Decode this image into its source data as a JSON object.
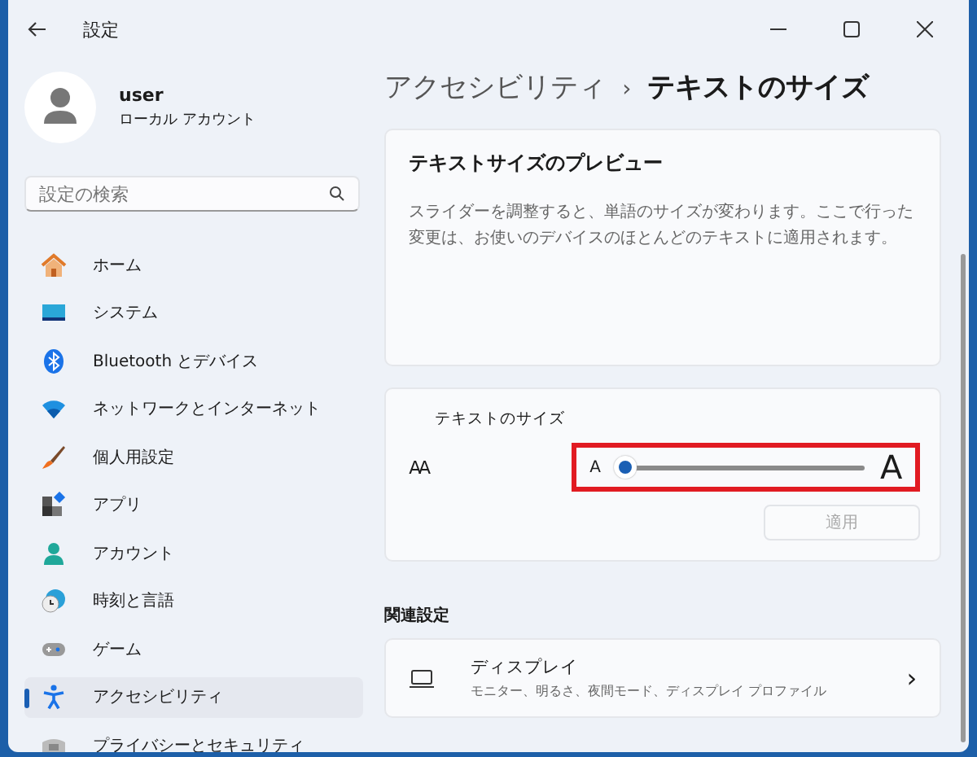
{
  "window": {
    "title": "設定"
  },
  "user": {
    "name": "user",
    "account": "ローカル アカウント"
  },
  "search": {
    "placeholder": "設定の検索"
  },
  "nav": [
    {
      "label": "ホーム",
      "kind": "home",
      "selected": false
    },
    {
      "label": "システム",
      "kind": "system",
      "selected": false
    },
    {
      "label": "Bluetooth とデバイス",
      "kind": "bluetooth",
      "selected": false
    },
    {
      "label": "ネットワークとインターネット",
      "kind": "network",
      "selected": false
    },
    {
      "label": "個人用設定",
      "kind": "brush",
      "selected": false
    },
    {
      "label": "アプリ",
      "kind": "apps",
      "selected": false
    },
    {
      "label": "アカウント",
      "kind": "account",
      "selected": false
    },
    {
      "label": "時刻と言語",
      "kind": "time",
      "selected": false
    },
    {
      "label": "ゲーム",
      "kind": "game",
      "selected": false
    },
    {
      "label": "アクセシビリティ",
      "kind": "accessibility",
      "selected": true
    },
    {
      "label": "プライバシーとセキュリティ",
      "kind": "privacy",
      "selected": false
    }
  ],
  "breadcrumb": {
    "parent": "アクセシビリティ",
    "separator": "›",
    "current": "テキストのサイズ"
  },
  "preview": {
    "title": "テキストサイズのプレビュー",
    "text": "スライダーを調整すると、単語のサイズが変わります。ここで行った変更は、お使いのデバイスのほとんどのテキストに適用されます。"
  },
  "text_size": {
    "label": "テキストのサイズ",
    "icon_text": "AA",
    "min_label": "A",
    "max_label": "A",
    "level": 0,
    "highlighted": true,
    "apply": {
      "label": "適用",
      "disabled": true
    }
  },
  "related": {
    "heading": "関連設定",
    "items": [
      {
        "title": "ディスプレイ",
        "subtitle": "モニター、明るさ、夜間モード、ディスプレイ プロファイル",
        "chevron": "›"
      }
    ]
  }
}
